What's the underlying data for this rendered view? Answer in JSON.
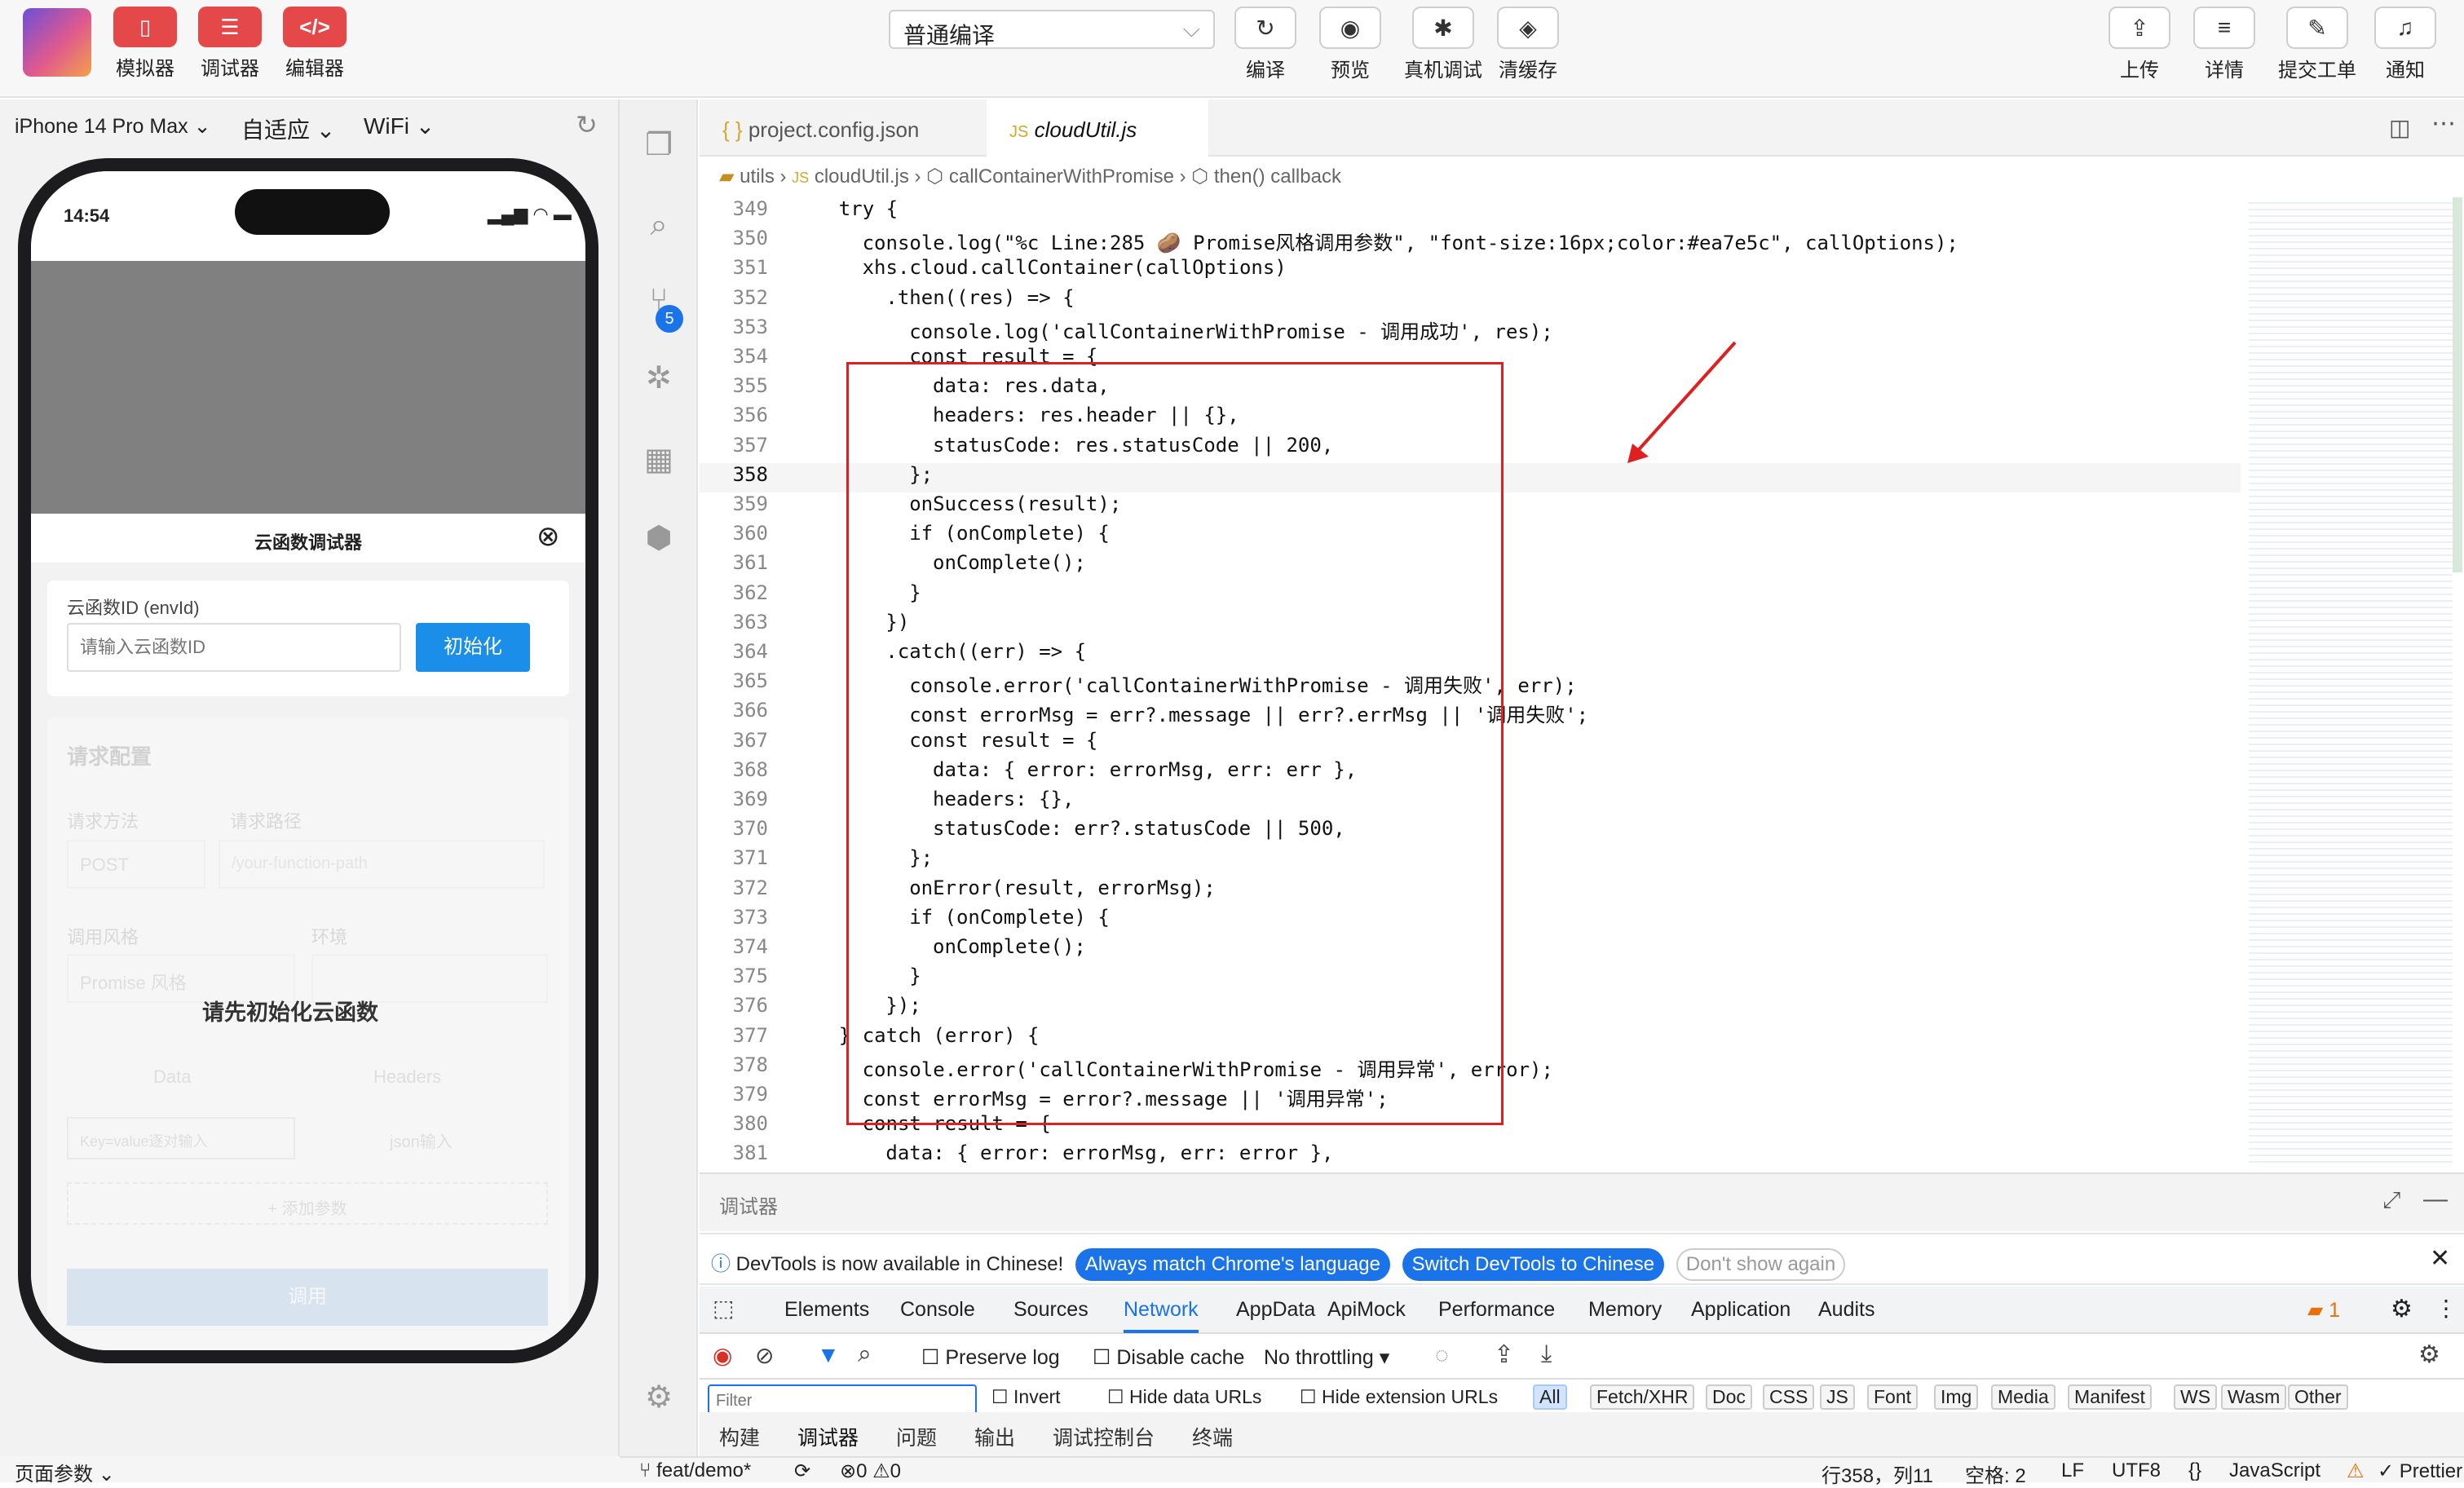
{
  "toolbar": {
    "left_buttons": [
      "模拟器",
      "调试器",
      "编辑器"
    ],
    "compile_mode": "普通编译",
    "center_buttons": [
      "编译",
      "预览",
      "真机调试",
      "清缓存"
    ],
    "right_buttons": [
      "上传",
      "详情",
      "提交工单",
      "通知"
    ]
  },
  "simulator": {
    "device": "iPhone 14 Pro Max",
    "scale": "自适应",
    "network": "WiFi",
    "time": "14:54",
    "panel_title": "云函数调试器",
    "envid_label": "云函数ID (envId)",
    "envid_placeholder": "请输入云函数ID",
    "init_button": "初始化",
    "config_title": "请求配置",
    "method_label": "请求方法",
    "path_label": "请求路径",
    "method_value": "POST",
    "path_placeholder": "/your-function-path",
    "style_label": "调用风格",
    "env_label": "环境",
    "style_value": "Promise 风格",
    "overlay_text": "请先初始化云函数",
    "tab_data": "Data",
    "tab_headers": "Headers",
    "kv_input": "Key=value逐对输入",
    "json_input": "json输入",
    "add_param": "+ 添加参数",
    "call_button": "调用",
    "page_params": "页面参数"
  },
  "editor": {
    "tabs": [
      "project.config.json",
      "cloudUtil.js"
    ],
    "breadcrumb": [
      "utils",
      "cloudUtil.js",
      "callContainerWithPromise",
      "then() callback"
    ],
    "lines": [
      {
        "n": "349",
        "i": 1,
        "t": "try {"
      },
      {
        "n": "350",
        "i": 2,
        "t": "console.log(\"%c Line:285 🥔 Promise风格调用参数\", \"font-size:16px;color:#ea7e5c\", callOptions);"
      },
      {
        "n": "351",
        "i": 2,
        "t": "xhs.cloud.callContainer(callOptions)"
      },
      {
        "n": "352",
        "i": 3,
        "t": ".then((res) => {"
      },
      {
        "n": "353",
        "i": 4,
        "t": "console.log('callContainerWithPromise - 调用成功', res);"
      },
      {
        "n": "354",
        "i": 4,
        "t": "const result = {"
      },
      {
        "n": "355",
        "i": 5,
        "t": "data: res.data,"
      },
      {
        "n": "356",
        "i": 5,
        "t": "headers: res.header || {},"
      },
      {
        "n": "357",
        "i": 5,
        "t": "statusCode: res.statusCode || 200,"
      },
      {
        "n": "358",
        "i": 4,
        "t": "};"
      },
      {
        "n": "359",
        "i": 4,
        "t": "onSuccess(result);"
      },
      {
        "n": "360",
        "i": 4,
        "t": "if (onComplete) {"
      },
      {
        "n": "361",
        "i": 5,
        "t": "onComplete();"
      },
      {
        "n": "362",
        "i": 4,
        "t": "}"
      },
      {
        "n": "363",
        "i": 3,
        "t": "})"
      },
      {
        "n": "364",
        "i": 3,
        "t": ".catch((err) => {"
      },
      {
        "n": "365",
        "i": 4,
        "t": "console.error('callContainerWithPromise - 调用失败', err);"
      },
      {
        "n": "366",
        "i": 4,
        "t": "const errorMsg = err?.message || err?.errMsg || '调用失败';"
      },
      {
        "n": "367",
        "i": 4,
        "t": "const result = {"
      },
      {
        "n": "368",
        "i": 5,
        "t": "data: { error: errorMsg, err: err },"
      },
      {
        "n": "369",
        "i": 5,
        "t": "headers: {},"
      },
      {
        "n": "370",
        "i": 5,
        "t": "statusCode: err?.statusCode || 500,"
      },
      {
        "n": "371",
        "i": 4,
        "t": "};"
      },
      {
        "n": "372",
        "i": 4,
        "t": "onError(result, errorMsg);"
      },
      {
        "n": "373",
        "i": 4,
        "t": "if (onComplete) {"
      },
      {
        "n": "374",
        "i": 5,
        "t": "onComplete();"
      },
      {
        "n": "375",
        "i": 4,
        "t": "}"
      },
      {
        "n": "376",
        "i": 3,
        "t": "});"
      },
      {
        "n": "377",
        "i": 1,
        "t": "} catch (error) {"
      },
      {
        "n": "378",
        "i": 2,
        "t": "console.error('callContainerWithPromise - 调用异常', error);"
      },
      {
        "n": "379",
        "i": 2,
        "t": "const errorMsg = error?.message || '调用异常';"
      },
      {
        "n": "380",
        "i": 2,
        "t": "const result = {"
      },
      {
        "n": "381",
        "i": 3,
        "t": "data: { error: errorMsg, err: error },"
      }
    ],
    "git_badge": "5"
  },
  "debugger": {
    "title": "调试器",
    "notice": "DevTools is now available in Chinese!",
    "btn_match": "Always match Chrome's language",
    "btn_switch": "Switch DevTools to Chinese",
    "btn_dismiss": "Don't show again",
    "tabs": [
      "Elements",
      "Console",
      "Sources",
      "Network",
      "AppData",
      "ApiMock",
      "Performance",
      "Memory",
      "Application",
      "Audits"
    ],
    "active_tab": "Network",
    "issue_count": "1",
    "preserve_log": "Preserve log",
    "disable_cache": "Disable cache",
    "throttling": "No throttling",
    "filter_placeholder": "Filter",
    "invert": "Invert",
    "hide_data": "Hide data URLs",
    "hide_ext": "Hide extension URLs",
    "types": [
      "All",
      "Fetch/XHR",
      "Doc",
      "CSS",
      "JS",
      "Font",
      "Img",
      "Media",
      "Manifest",
      "WS",
      "Wasm",
      "Other"
    ],
    "bottom_tabs": [
      "构建",
      "调试器",
      "问题",
      "输出",
      "调试控制台",
      "终端"
    ],
    "active_bottom_tab": "调试器"
  },
  "status": {
    "branch": "feat/demo*",
    "errors": "0",
    "warnings": "0",
    "position": "行358，列11",
    "spaces": "空格: 2",
    "eol": "LF",
    "encoding": "UTF8",
    "language": "JavaScript",
    "formatter": "Prettier"
  }
}
